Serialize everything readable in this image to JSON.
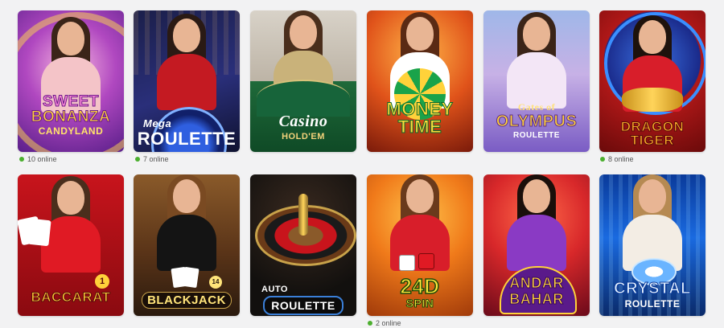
{
  "row1": [
    {
      "name": "sweet-bonanza-candyland",
      "line1": "SWEET",
      "line2": "BONANZA",
      "line3": "CANDYLAND",
      "online": "10 online"
    },
    {
      "name": "mega-roulette",
      "line1": "Mega",
      "line2": "ROULETTE",
      "online": "7 online"
    },
    {
      "name": "casino-holdem",
      "line1": "Casino",
      "line2": "HOLD'EM"
    },
    {
      "name": "money-time",
      "line1": "MONEY",
      "line2": "TIME"
    },
    {
      "name": "gates-of-olympus-roulette",
      "line1": "Gates of",
      "line2": "OLYMPUS",
      "line3": "ROULETTE"
    },
    {
      "name": "dragon-tiger",
      "line1": "DRAGON",
      "line2": "TIGER",
      "online": "8 online"
    }
  ],
  "row2": [
    {
      "name": "baccarat",
      "line1": "BACCARAT",
      "badge": "1"
    },
    {
      "name": "blackjack",
      "line1": "BLACKJACK",
      "badge": "14"
    },
    {
      "name": "auto-roulette",
      "line1": "AUTO",
      "line2": "ROULETTE"
    },
    {
      "name": "24d-spin",
      "line1": "24D",
      "line2": "SPIN",
      "online": "2 online"
    },
    {
      "name": "andar-bahar",
      "line1": "ANDAR",
      "line2": "BAHAR"
    },
    {
      "name": "crystal-roulette",
      "line1": "CRYSTAL",
      "line2": "ROULETTE"
    }
  ],
  "colors": {
    "online_dot": "#4caf2f",
    "background": "#f2f2f3"
  }
}
